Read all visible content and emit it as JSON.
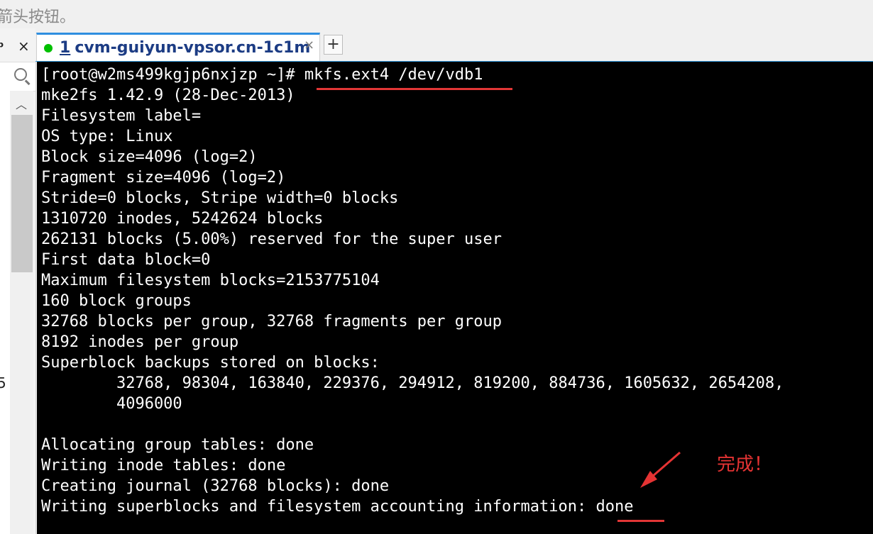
{
  "top_note": "箭头按钮。",
  "left_panel": {
    "pin_glyph": "ᵖ",
    "close_glyph": "×",
    "peek_text": "5"
  },
  "tab": {
    "number": "1",
    "title": "cvm-guiyun-vpsor.cn-1c1m",
    "close_glyph": "×",
    "new_tab_glyph": "+"
  },
  "terminal": {
    "lines": [
      "[root@w2ms499kgjp6nxjzp ~]# mkfs.ext4 /dev/vdb1",
      "mke2fs 1.42.9 (28-Dec-2013)",
      "Filesystem label=",
      "OS type: Linux",
      "Block size=4096 (log=2)",
      "Fragment size=4096 (log=2)",
      "Stride=0 blocks, Stripe width=0 blocks",
      "1310720 inodes, 5242624 blocks",
      "262131 blocks (5.00%) reserved for the super user",
      "First data block=0",
      "Maximum filesystem blocks=2153775104",
      "160 block groups",
      "32768 blocks per group, 32768 fragments per group",
      "8192 inodes per group",
      "Superblock backups stored on blocks:",
      "        32768, 98304, 163840, 229376, 294912, 819200, 884736, 1605632, 2654208,",
      "        4096000",
      "",
      "Allocating group tables: done",
      "Writing inode tables: done",
      "Creating journal (32768 blocks): done",
      "Writing superblocks and filesystem accounting information: done"
    ]
  },
  "annotation": {
    "text": "完成！",
    "color": "#e53333"
  },
  "colors": {
    "accent": "#2f8fe0",
    "status_online": "#00c000",
    "terminal_bg": "#000000",
    "terminal_fg": "#ffffff"
  }
}
